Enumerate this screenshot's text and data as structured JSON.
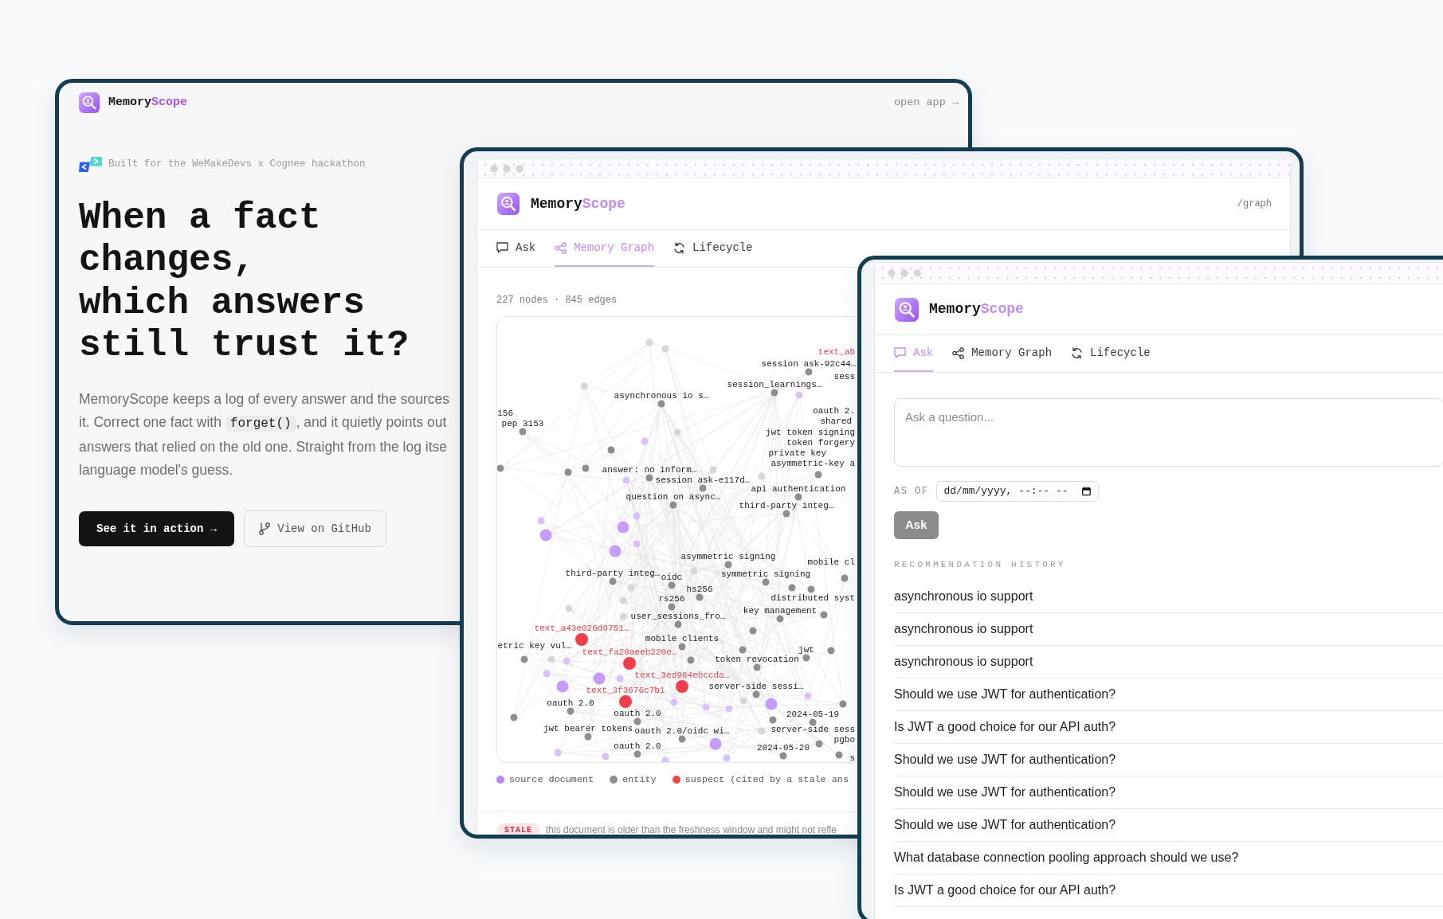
{
  "landing": {
    "brand": {
      "name": "Memory",
      "accent": "Scope"
    },
    "open_app_link": "open app →",
    "hackathon_note": "Built for the WeMakeDevs x Cognee hackathon",
    "headline": "When a fact\nchanges,\nwhich answers\nstill trust it?",
    "description": [
      [
        {
          "text": "MemoryScope keeps a log of every answer and the sources"
        }
      ],
      [
        {
          "text": "it. Correct one fact with "
        },
        {
          "text": "forget()",
          "code": true
        },
        {
          "text": ", and it quietly points out"
        }
      ],
      [
        {
          "text": "answers that relied on the old one. Straight from the log itse"
        }
      ],
      [
        {
          "text": "language model's guess."
        }
      ]
    ],
    "buttons": [
      {
        "label": "See it in action →",
        "kind": "primary"
      },
      {
        "label": "View on GitHub",
        "kind": "outline"
      }
    ]
  },
  "graph_window": {
    "brand": {
      "name": "Memory",
      "accent": "Scope"
    },
    "route": "/graph",
    "tabs": [
      {
        "label": "Ask",
        "selected": false
      },
      {
        "label": "Memory Graph",
        "selected": true
      },
      {
        "label": "Lifecycle",
        "selected": false
      }
    ],
    "stats": "227 nodes · 845 edges",
    "nodes": [
      {
        "kind": "faint"
      },
      {
        "kind": "faint"
      },
      {
        "kind": "suspect",
        "label": "text_ab"
      },
      {
        "kind": "entity",
        "label": "session ask-92c44…"
      },
      {
        "kind": "entity",
        "label": "sess"
      },
      {
        "kind": "faint"
      },
      {
        "kind": "entity",
        "label": "session_learnings…"
      },
      {
        "kind": "chunk"
      },
      {
        "kind": "entity",
        "label": "asynchronous io s…"
      },
      {
        "kind": "entity",
        "label": "oauth 2."
      },
      {
        "kind": "entity",
        "label": "156"
      },
      {
        "kind": "entity",
        "label": "shared"
      },
      {
        "kind": "entity",
        "label": "pep 3153"
      },
      {
        "kind": "faint"
      },
      {
        "kind": "entity",
        "label": "jwt token signing"
      },
      {
        "kind": "entity",
        "label": "token forgery"
      },
      {
        "kind": "chunk"
      },
      {
        "kind": "entity"
      },
      {
        "kind": "entity",
        "label": "private key"
      },
      {
        "kind": "entity",
        "label": "asymmetric-key a"
      },
      {
        "kind": "entity"
      },
      {
        "kind": "entity"
      },
      {
        "kind": "entity"
      },
      {
        "kind": "entity"
      },
      {
        "kind": "entity",
        "label": "answer: no inform…"
      },
      {
        "kind": "faint"
      },
      {
        "kind": "entity",
        "label": "session ask-e117d…"
      },
      {
        "kind": "chunk"
      },
      {
        "kind": "faint"
      },
      {
        "kind": "entity",
        "label": "question on async…"
      },
      {
        "kind": "entity",
        "label": "api authentication"
      },
      {
        "kind": "entity",
        "label": "third-party integ…"
      },
      {
        "kind": "chunk"
      },
      {
        "kind": "chunk"
      },
      {
        "kind": "source"
      },
      {
        "kind": "source"
      },
      {
        "kind": "source"
      },
      {
        "kind": "chunk"
      },
      {
        "kind": "entity",
        "label": "asymmetric signing"
      },
      {
        "kind": "faint"
      },
      {
        "kind": "entity",
        "label": "third-party integ…"
      },
      {
        "kind": "entity",
        "label": "oidc"
      },
      {
        "kind": "entity",
        "label": "symmetric signing"
      },
      {
        "kind": "entity",
        "label": "mobile cl"
      },
      {
        "kind": "entity"
      },
      {
        "kind": "faint"
      },
      {
        "kind": "entity",
        "label": "hs256"
      },
      {
        "kind": "faint"
      },
      {
        "kind": "faint"
      },
      {
        "kind": "faint"
      },
      {
        "kind": "entity",
        "label": "rs256"
      },
      {
        "kind": "entity"
      },
      {
        "kind": "entity"
      },
      {
        "kind": "entity",
        "label": "distributed syst"
      },
      {
        "kind": "entity",
        "label": "key management"
      },
      {
        "kind": "entity"
      },
      {
        "kind": "entity",
        "label": "user_sessions_fro…"
      },
      {
        "kind": "entity"
      },
      {
        "kind": "suspect",
        "label": "text_a43e026d0751…"
      },
      {
        "kind": "entity",
        "label": "mobile clients"
      },
      {
        "kind": "entity",
        "label": "etric key vul…"
      },
      {
        "kind": "entity"
      },
      {
        "kind": "faint"
      },
      {
        "kind": "chunk"
      },
      {
        "kind": "suspect",
        "label": "text_fa20aeeb220e…"
      },
      {
        "kind": "entity"
      },
      {
        "kind": "entity",
        "label": "jwt"
      },
      {
        "kind": "entity"
      },
      {
        "kind": "entity",
        "label": "token revocation"
      },
      {
        "kind": "entity"
      },
      {
        "kind": "suspect",
        "label": "text_3ed984ebccda…"
      },
      {
        "kind": "source"
      },
      {
        "kind": "chunk"
      },
      {
        "kind": "source"
      },
      {
        "kind": "chunk"
      },
      {
        "kind": "entity",
        "label": "server-side sessi…"
      },
      {
        "kind": "source"
      },
      {
        "kind": "chunk"
      },
      {
        "kind": "suspect",
        "label": "text_3f3676c7b1"
      },
      {
        "kind": "chunk"
      },
      {
        "kind": "faint"
      },
      {
        "kind": "chunk"
      },
      {
        "kind": "chunk"
      },
      {
        "kind": "entity",
        "label": "oauth 2.0"
      },
      {
        "kind": "entity",
        "label": "oauth 2.0"
      },
      {
        "kind": "entity"
      },
      {
        "kind": "entity",
        "label": "2024-05-19"
      },
      {
        "kind": "entity"
      },
      {
        "kind": "entity"
      },
      {
        "kind": "entity",
        "label": "jwt bearer tokens"
      },
      {
        "kind": "entity",
        "label": "oauth 2.0/oidc wi…"
      },
      {
        "kind": "faint"
      },
      {
        "kind": "entity",
        "label": "server-side sess"
      },
      {
        "kind": "entity",
        "label": "pgbo"
      },
      {
        "kind": "entity"
      },
      {
        "kind": "source"
      },
      {
        "kind": "entity",
        "label": "oauth 2.0"
      },
      {
        "kind": "entity",
        "label": "2024-05-20"
      },
      {
        "kind": "entity"
      },
      {
        "kind": "entity",
        "label": "s"
      },
      {
        "kind": "chunk"
      },
      {
        "kind": "chunk"
      },
      {
        "kind": "chunk"
      },
      {
        "kind": "chunk"
      }
    ],
    "legend": [
      {
        "label": "source document",
        "color": "#c084fc"
      },
      {
        "label": "entity",
        "color": "#8e8e8e"
      },
      {
        "label": "suspect (cited by a stale ans",
        "color": "#ef4444"
      }
    ],
    "notice": {
      "badge": "STALE",
      "text": "this document is older than the freshness window and might not refle"
    }
  },
  "ask_window": {
    "brand": {
      "name": "Memory",
      "accent": "Scope"
    },
    "tabs": [
      {
        "label": "Ask",
        "selected": true
      },
      {
        "label": "Memory Graph",
        "selected": false
      },
      {
        "label": "Lifecycle",
        "selected": false
      }
    ],
    "question": {
      "placeholder": "Ask a question..."
    },
    "as_of": {
      "label": "AS OF",
      "placeholder": "dd/mm/yyyy, --:-- --"
    },
    "ask_button": {
      "label": "Ask",
      "disabled": true
    },
    "history_title": "RECOMMENDATION HISTORY",
    "history": [
      "asynchronous io support",
      "asynchronous io support",
      "asynchronous io support",
      "Should we use JWT for authentication?",
      "Is JWT a good choice for our API auth?",
      "Should we use JWT for authentication?",
      "Should we use JWT for authentication?",
      "Should we use JWT for authentication?",
      "What database connection pooling approach should we use?",
      "Is JWT a good choice for our API auth?"
    ]
  }
}
